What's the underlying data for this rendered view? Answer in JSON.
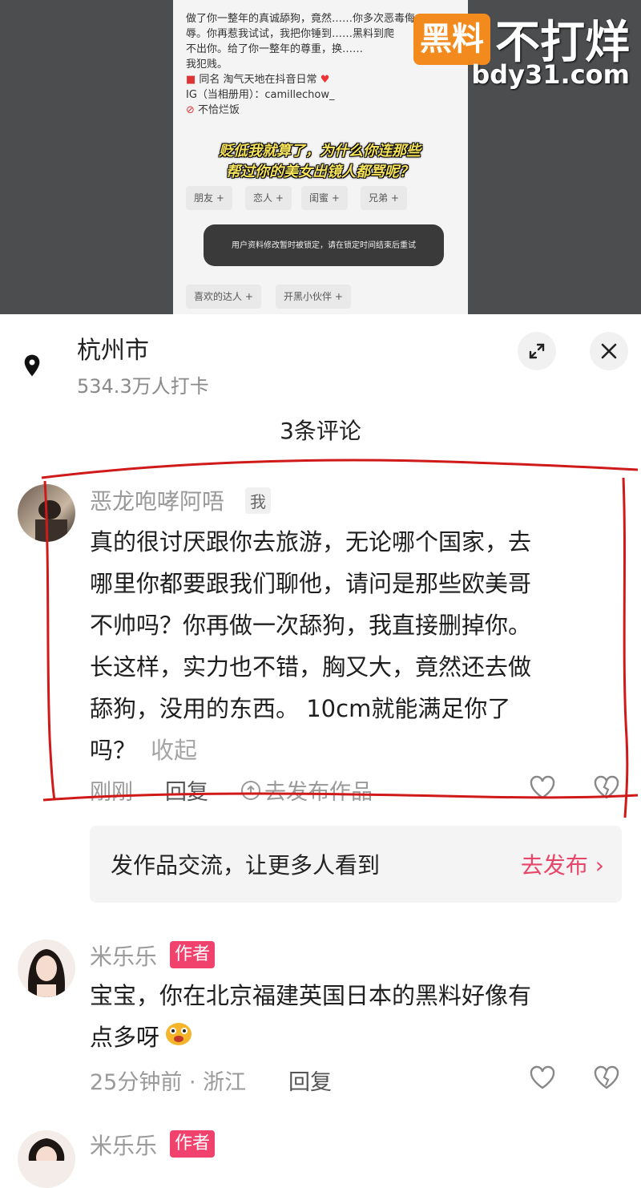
{
  "screenshot_top": {
    "bio_lines": [
      "做了你一整年的真诚舔狗，竟然……你多次恶毒侮",
      "辱。你再惹我试试，我把你锤到……黑料到爬",
      "不出你。给了你一整年的尊重，换……",
      "我犯贱。",
      "同名  淘气天地在抖音日常",
      "IG（当相册用）：camillechow_",
      "不恰烂饭"
    ],
    "caption_line1": "贬低我就算了，为什么你连那些",
    "caption_line2": "帮过你的美女出镜人都骂呢？",
    "tags": [
      "朋友 +",
      "恋人 +",
      "闺蜜 +",
      "兄弟 +",
      "喜欢的达人 +",
      "开黑小伙伴 +"
    ],
    "toast": "用户资料修改暂时被锁定，请在锁定时间结束后重试"
  },
  "watermark": {
    "badge": "黑料",
    "title": "不打烊",
    "url": "bdy31.com"
  },
  "location": {
    "city": "杭州市",
    "checkins": "534.3万人打卡"
  },
  "comments_title": "3条评论",
  "comments": [
    {
      "name": "恶龙咆哮阿唔",
      "badge": "我",
      "lines": [
        "真的很讨厌跟你去旅游，无论哪个国家，去",
        "哪里你都要跟我们聊他，请问是那些欧美哥",
        "不帅吗？你再做一次舔狗，我直接删掉你。",
        "长这样，实力也不错，胸又大，竟然还去做",
        "舔狗，没用的东西。  10cm就能满足你了",
        "吗？"
      ],
      "collapse": "收起",
      "time": "刚刚",
      "reply": "回复",
      "publish": "去发布作品"
    },
    {
      "name": "米乐乐",
      "badge": "作者",
      "lines": [
        "宝宝，你在北京福建英国日本的黑料好像有",
        "点多呀"
      ],
      "time": "25分钟前 · 浙江",
      "reply": "回复"
    },
    {
      "name": "米乐乐",
      "badge": "作者"
    }
  ],
  "promo": {
    "text": "发作品交流，让更多人看到",
    "link": "去发布 ›"
  },
  "colors": {
    "accent_pink": "#f0426c",
    "link_pink": "#e8456a",
    "annotation_red": "#d01a1a",
    "watermark_orange": "#f28a1e"
  }
}
